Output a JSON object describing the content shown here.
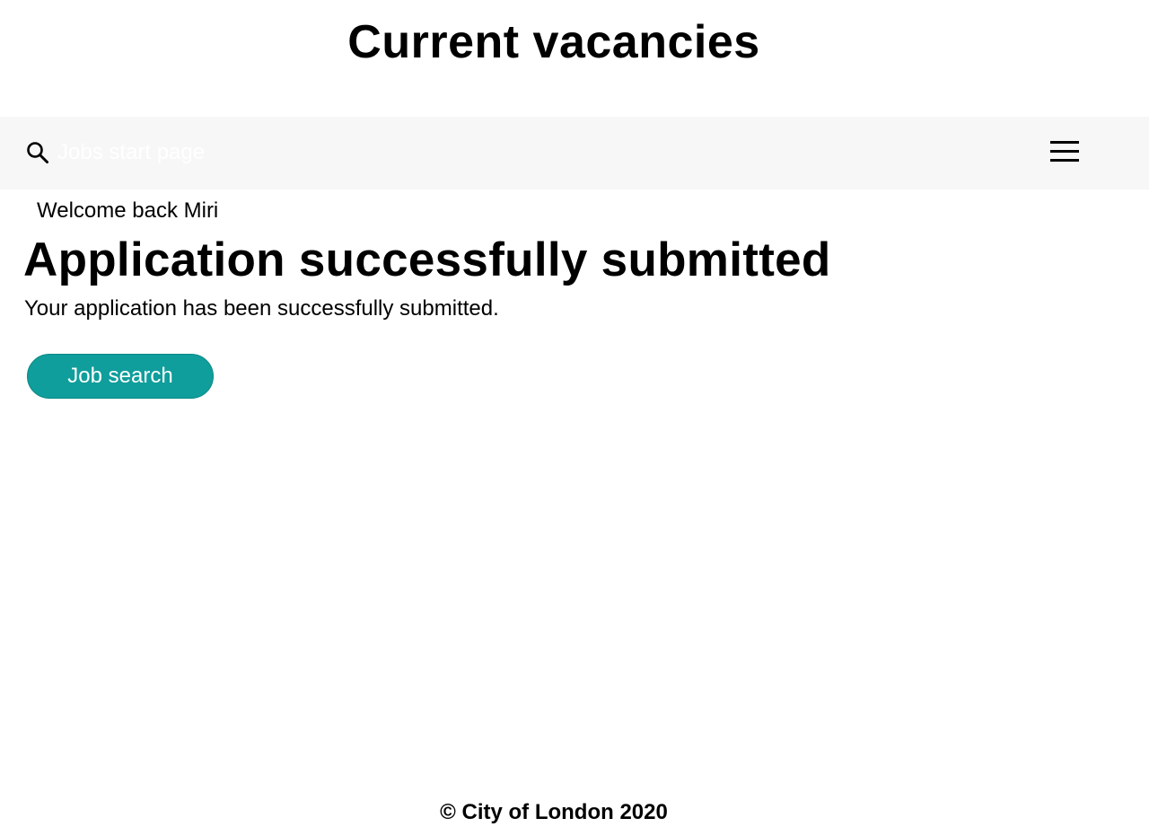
{
  "header": {
    "title": "Current vacancies"
  },
  "nav": {
    "search_icon": "search-icon",
    "start_link_label": "Jobs start page",
    "menu_icon": "hamburger-menu-icon"
  },
  "main": {
    "welcome": "Welcome back Miri",
    "heading": "Application successfully submitted",
    "message": "Your application has been successfully submitted.",
    "job_search_button_label": "Job search"
  },
  "footer": {
    "copyright": "© City of London 2020"
  },
  "colors": {
    "navbar_bg": "#f7f7f7",
    "button_bg": "#0f9e9b",
    "text": "#000000"
  }
}
